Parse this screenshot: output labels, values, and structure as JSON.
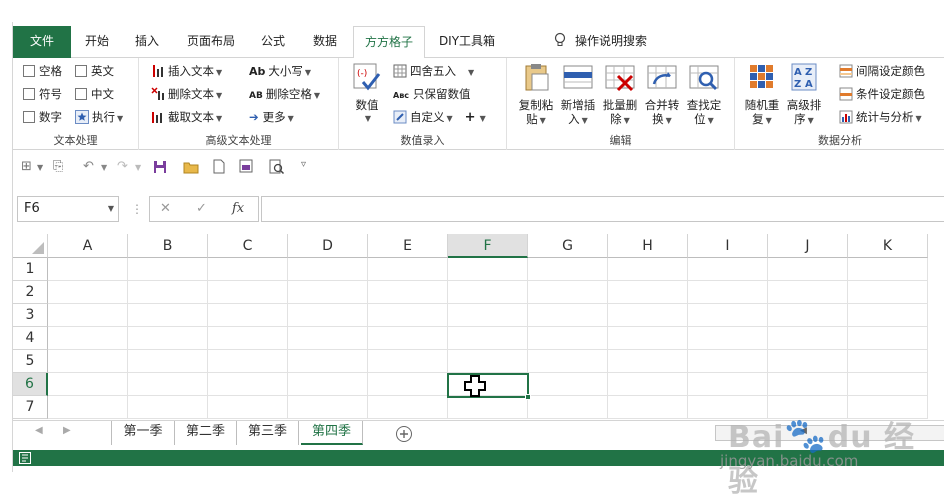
{
  "ribbon_tabs": [
    "文件",
    "开始",
    "插入",
    "页面布局",
    "公式",
    "数据",
    "方方格子",
    "DIY工具箱"
  ],
  "tell_me": "操作说明搜索",
  "groups": {
    "text": {
      "label": "文本处理",
      "checks": [
        "空格",
        "英文",
        "符号",
        "中文",
        "数字"
      ],
      "execute": "执行"
    },
    "adv_text": {
      "label": "高级文本处理",
      "items": [
        "插入文本",
        "大小写",
        "删除文本",
        "删除空格",
        "截取文本",
        "更多"
      ]
    },
    "num_input": {
      "label": "数值录入",
      "big": "数值",
      "items": [
        "四舍五入",
        "只保留数值",
        "自定义"
      ]
    },
    "edit": {
      "label": "编辑",
      "buttons": [
        {
          "l1": "复制粘",
          "l2": "贴"
        },
        {
          "l1": "新增插",
          "l2": "入"
        },
        {
          "l1": "批量删",
          "l2": "除"
        },
        {
          "l1": "合并转",
          "l2": "换"
        },
        {
          "l1": "查找定",
          "l2": "位"
        }
      ]
    },
    "analysis": {
      "label": "数据分析",
      "buttons": [
        {
          "l1": "随机重",
          "l2": "复"
        },
        {
          "l1": "高级排",
          "l2": "序"
        }
      ],
      "items": [
        "间隔设定颜色",
        "条件设定颜色",
        "统计与分析"
      ]
    }
  },
  "formula_bar": {
    "name_box": "F6",
    "fx": "fx",
    "value": ""
  },
  "columns": [
    "A",
    "B",
    "C",
    "D",
    "E",
    "F",
    "G",
    "H",
    "I",
    "J",
    "K"
  ],
  "rows": [
    "1",
    "2",
    "3",
    "4",
    "5",
    "6",
    "7"
  ],
  "selected": {
    "col": "F",
    "row": "6"
  },
  "sheets": [
    "第一季",
    "第二季",
    "第三季",
    "第四季"
  ],
  "active_sheet": "第四季",
  "watermark": {
    "brand": "Bai du 经验",
    "url": "jingyan.baidu.com"
  },
  "colors": {
    "accent": "#217346"
  }
}
